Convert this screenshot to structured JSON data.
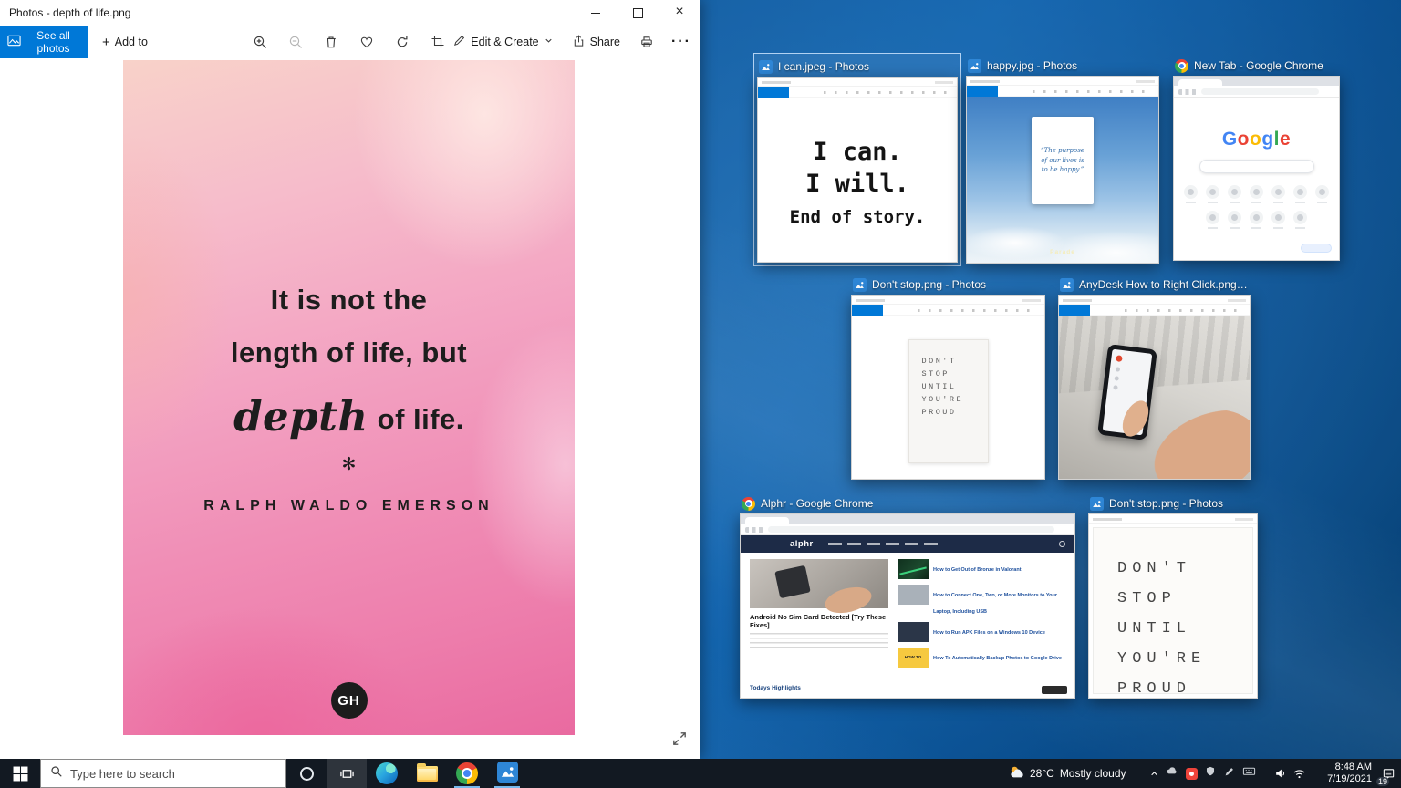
{
  "photos": {
    "title": "Photos - depth of life.png",
    "see_all_photos": "See all photos",
    "add_to": "Add to",
    "edit_create": "Edit & Create",
    "share": "Share"
  },
  "photo": {
    "line1": "It is not the",
    "line2": "length of life, but",
    "word_script": "depth",
    "line3_rest": "of life.",
    "ornament": "✻",
    "author": "RALPH WALDO EMERSON",
    "logo": "GH"
  },
  "snap": {
    "items": [
      {
        "title": "I can.jpeg - Photos",
        "l1": "I can.",
        "l2": "I will.",
        "l3": "End of story."
      },
      {
        "title": "happy.jpg - Photos",
        "quote": "“The purpose of our lives is to be happy.”",
        "credit": "Parade"
      },
      {
        "title": "New Tab - Google Chrome",
        "logo": [
          "G",
          "o",
          "o",
          "g",
          "l",
          "e"
        ]
      },
      {
        "title": "Don't stop.png - Photos",
        "l1": "DON'T",
        "l2": "STOP",
        "l3": "UNTIL",
        "l4": "YOU'RE",
        "l5": "PROUD"
      },
      {
        "title": "AnyDesk How to Right Click.png - Pho..."
      },
      {
        "title": "Alphr - Google Chrome",
        "site": "alphr",
        "headline": "Android No Sim Card Detected [Try These Fixes]",
        "section": "Todays Highlights",
        "badge": "HOW TO",
        "articles": [
          "How to Get Out of Bronze in Valorant",
          "How to Connect One, Two, or More Monitors to Your Laptop, Including USB",
          "How to Run APK Files on a Windows 10 Device",
          "How To Automatically Backup Photos to Google Drive"
        ]
      },
      {
        "title": "Don't stop.png - Photos",
        "l1": "DON'T",
        "l2": "STOP",
        "l3": "UNTIL",
        "l4": "YOU'RE",
        "l5": "PROUD"
      }
    ]
  },
  "taskbar": {
    "search_placeholder": "Type here to search",
    "weather_temp": "28°C",
    "weather_desc": "Mostly cloudy",
    "time": "8:48 AM",
    "date": "7/19/2021",
    "badge": "19"
  }
}
